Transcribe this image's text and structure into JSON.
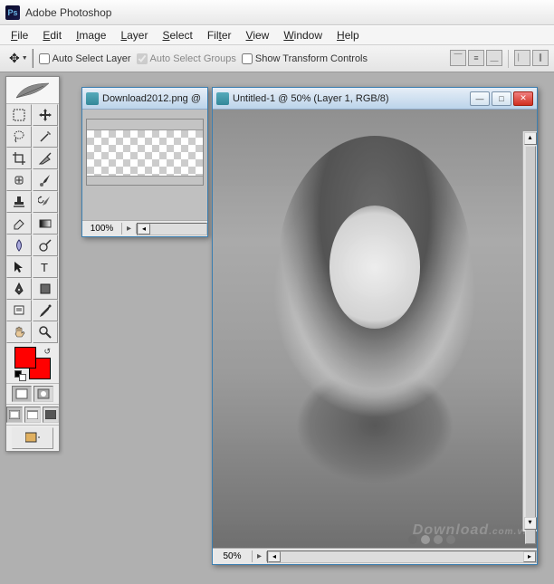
{
  "app": {
    "title": "Adobe Photoshop",
    "icon_label": "Ps"
  },
  "menu": {
    "items": [
      {
        "label": "File",
        "u": "F"
      },
      {
        "label": "Edit",
        "u": "E"
      },
      {
        "label": "Image",
        "u": "I"
      },
      {
        "label": "Layer",
        "u": "L"
      },
      {
        "label": "Select",
        "u": "S"
      },
      {
        "label": "Filter",
        "u": "t"
      },
      {
        "label": "View",
        "u": "V"
      },
      {
        "label": "Window",
        "u": "W"
      },
      {
        "label": "Help",
        "u": "H"
      }
    ]
  },
  "options": {
    "auto_select_layer": "Auto Select Layer",
    "auto_select_groups": "Auto Select Groups",
    "show_transform": "Show Transform Controls"
  },
  "toolbox": {
    "colors": {
      "fg": "#ff0000",
      "bg": "#ff0000"
    }
  },
  "docs": {
    "doc1": {
      "title": "Download2012.png @",
      "zoom": "100%"
    },
    "doc2": {
      "title": "Untitled-1 @ 50% (Layer 1, RGB/8)",
      "zoom": "50%"
    }
  },
  "watermark": {
    "text": "Download",
    "suffix": ".com.vn"
  }
}
